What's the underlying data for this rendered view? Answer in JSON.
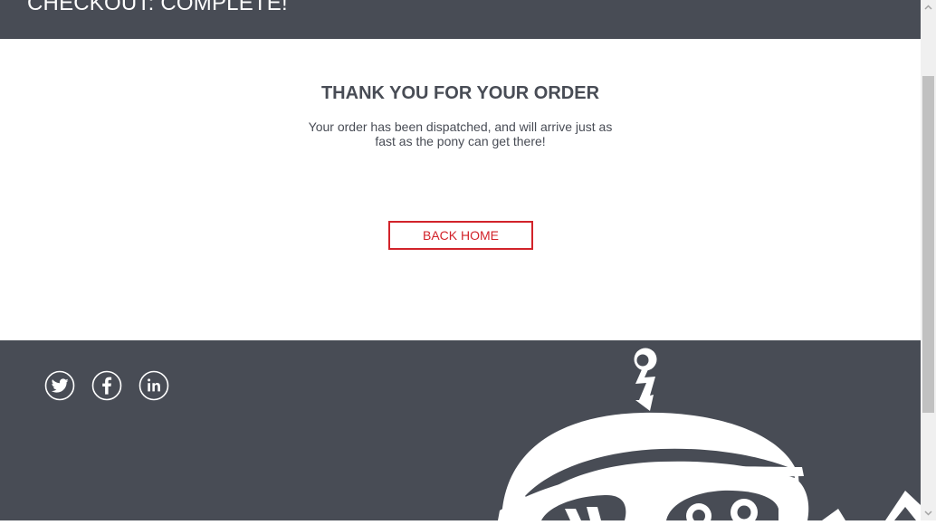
{
  "header": {
    "title": "CHECKOUT: COMPLETE!"
  },
  "main": {
    "heading": "THANK YOU FOR YOUR ORDER",
    "message": "Your order has been dispatched, and will arrive just as fast as the pony can get there!",
    "back_button_label": "BACK HOME"
  },
  "footer": {
    "social": [
      {
        "icon": "twitter-icon"
      },
      {
        "icon": "facebook-icon"
      },
      {
        "icon": "linkedin-icon"
      }
    ],
    "mascot": "pony-robot-mascot"
  },
  "colors": {
    "header_bg": "#484c55",
    "footer_bg": "#484c55",
    "text": "#484c55",
    "accent": "#d2232a",
    "background": "#ffffff"
  }
}
